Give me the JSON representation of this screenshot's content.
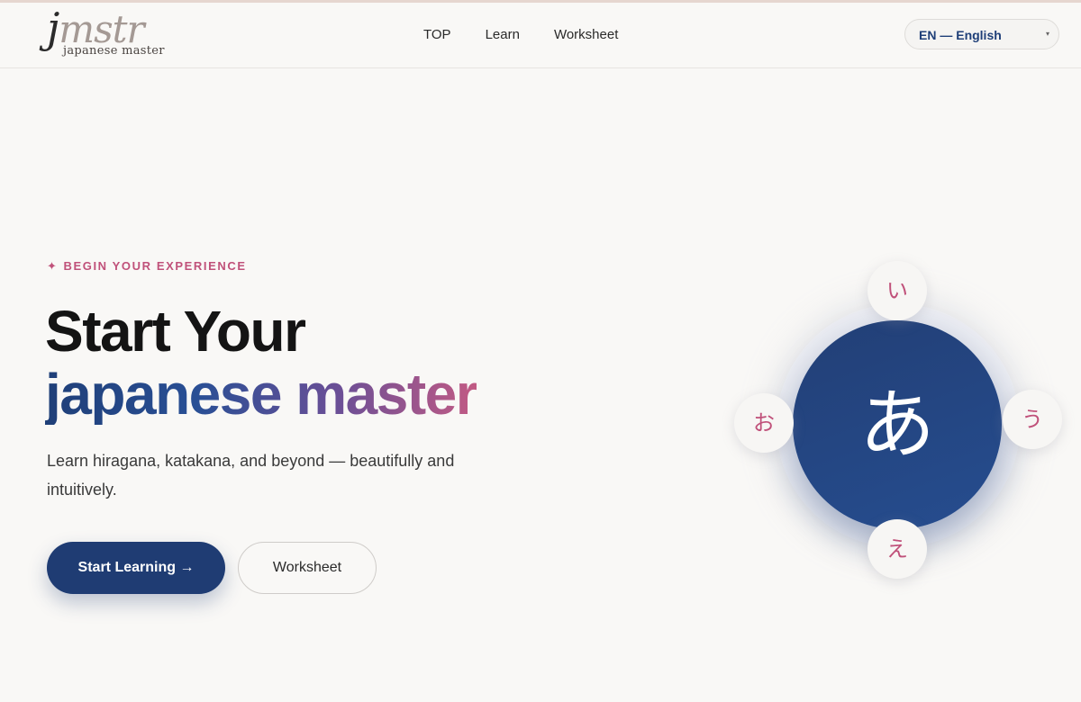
{
  "header": {
    "logo": {
      "mark": "jmstr",
      "subtitle": "japanese master"
    },
    "nav": [
      {
        "label": "TOP"
      },
      {
        "label": "Learn"
      },
      {
        "label": "Worksheet"
      }
    ],
    "language_select": {
      "selected": "EN — English"
    }
  },
  "hero": {
    "eyebrow_icon": "✦",
    "eyebrow": "BEGIN YOUR EXPERIENCE",
    "title_line1": "Start Your",
    "title_line2": "japanese master",
    "lead": "Learn hiragana, katakana, and beyond — beautifully and intuitively.",
    "primary_button": "Start Learning →",
    "secondary_button": "Worksheet"
  },
  "kana_wheel": {
    "center": "あ",
    "top": "い",
    "right": "う",
    "bottom": "え",
    "left": "お"
  },
  "colors": {
    "accent_navy": "#1f3c73",
    "accent_pink": "#c0517a",
    "background": "#f9f8f6"
  }
}
